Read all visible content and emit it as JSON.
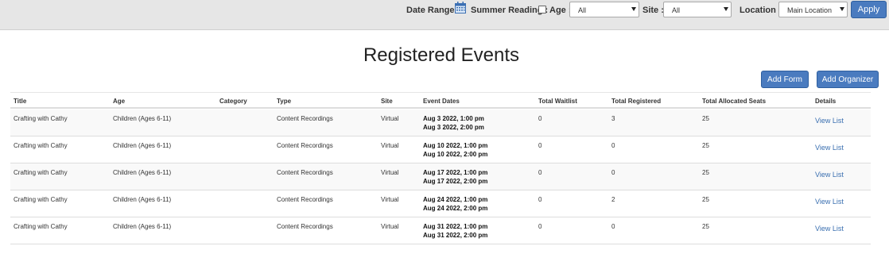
{
  "filters": {
    "date_range_label": "Date Range :",
    "summer_reading_label": "Summer Reading :",
    "age_label": "Age :",
    "age_value": "All",
    "site_label": "Site :",
    "site_value": "All",
    "location_label": "Location :",
    "location_value": "Main Location",
    "apply_label": "Apply",
    "calendar_icon": "calendar-icon",
    "summer_reading_checked": false
  },
  "page": {
    "title": "Registered Events",
    "add_form_label": "Add Form",
    "add_organizer_label": "Add Organizer"
  },
  "table": {
    "headers": {
      "title": "Title",
      "age": "Age",
      "category": "Category",
      "type": "Type",
      "site": "Site",
      "dates": "Event Dates",
      "waitlist": "Total Waitlist",
      "registered": "Total Registered",
      "seats": "Total Allocated Seats",
      "details": "Details"
    },
    "rows": [
      {
        "title": "Crafting with Cathy",
        "age": "Children (Ages 6-11)",
        "category": "",
        "type": "Content Recordings",
        "site": "Virtual",
        "start": "Aug 3 2022, 1:00 pm",
        "end": "Aug 3 2022, 2:00 pm",
        "waitlist": "0",
        "registered": "3",
        "seats": "25",
        "details": "View List"
      },
      {
        "title": "Crafting with Cathy",
        "age": "Children (Ages 6-11)",
        "category": "",
        "type": "Content Recordings",
        "site": "Virtual",
        "start": "Aug 10 2022, 1:00 pm",
        "end": "Aug 10 2022, 2:00 pm",
        "waitlist": "0",
        "registered": "0",
        "seats": "25",
        "details": "View List"
      },
      {
        "title": "Crafting with Cathy",
        "age": "Children (Ages 6-11)",
        "category": "",
        "type": "Content Recordings",
        "site": "Virtual",
        "start": "Aug 17 2022, 1:00 pm",
        "end": "Aug 17 2022, 2:00 pm",
        "waitlist": "0",
        "registered": "0",
        "seats": "25",
        "details": "View List"
      },
      {
        "title": "Crafting with Cathy",
        "age": "Children (Ages 6-11)",
        "category": "",
        "type": "Content Recordings",
        "site": "Virtual",
        "start": "Aug 24 2022, 1:00 pm",
        "end": "Aug 24 2022, 2:00 pm",
        "waitlist": "0",
        "registered": "2",
        "seats": "25",
        "details": "View List"
      },
      {
        "title": "Crafting with Cathy",
        "age": "Children (Ages 6-11)",
        "category": "",
        "type": "Content Recordings",
        "site": "Virtual",
        "start": "Aug 31 2022, 1:00 pm",
        "end": "Aug 31 2022, 2:00 pm",
        "waitlist": "0",
        "registered": "0",
        "seats": "25",
        "details": "View List"
      }
    ]
  }
}
